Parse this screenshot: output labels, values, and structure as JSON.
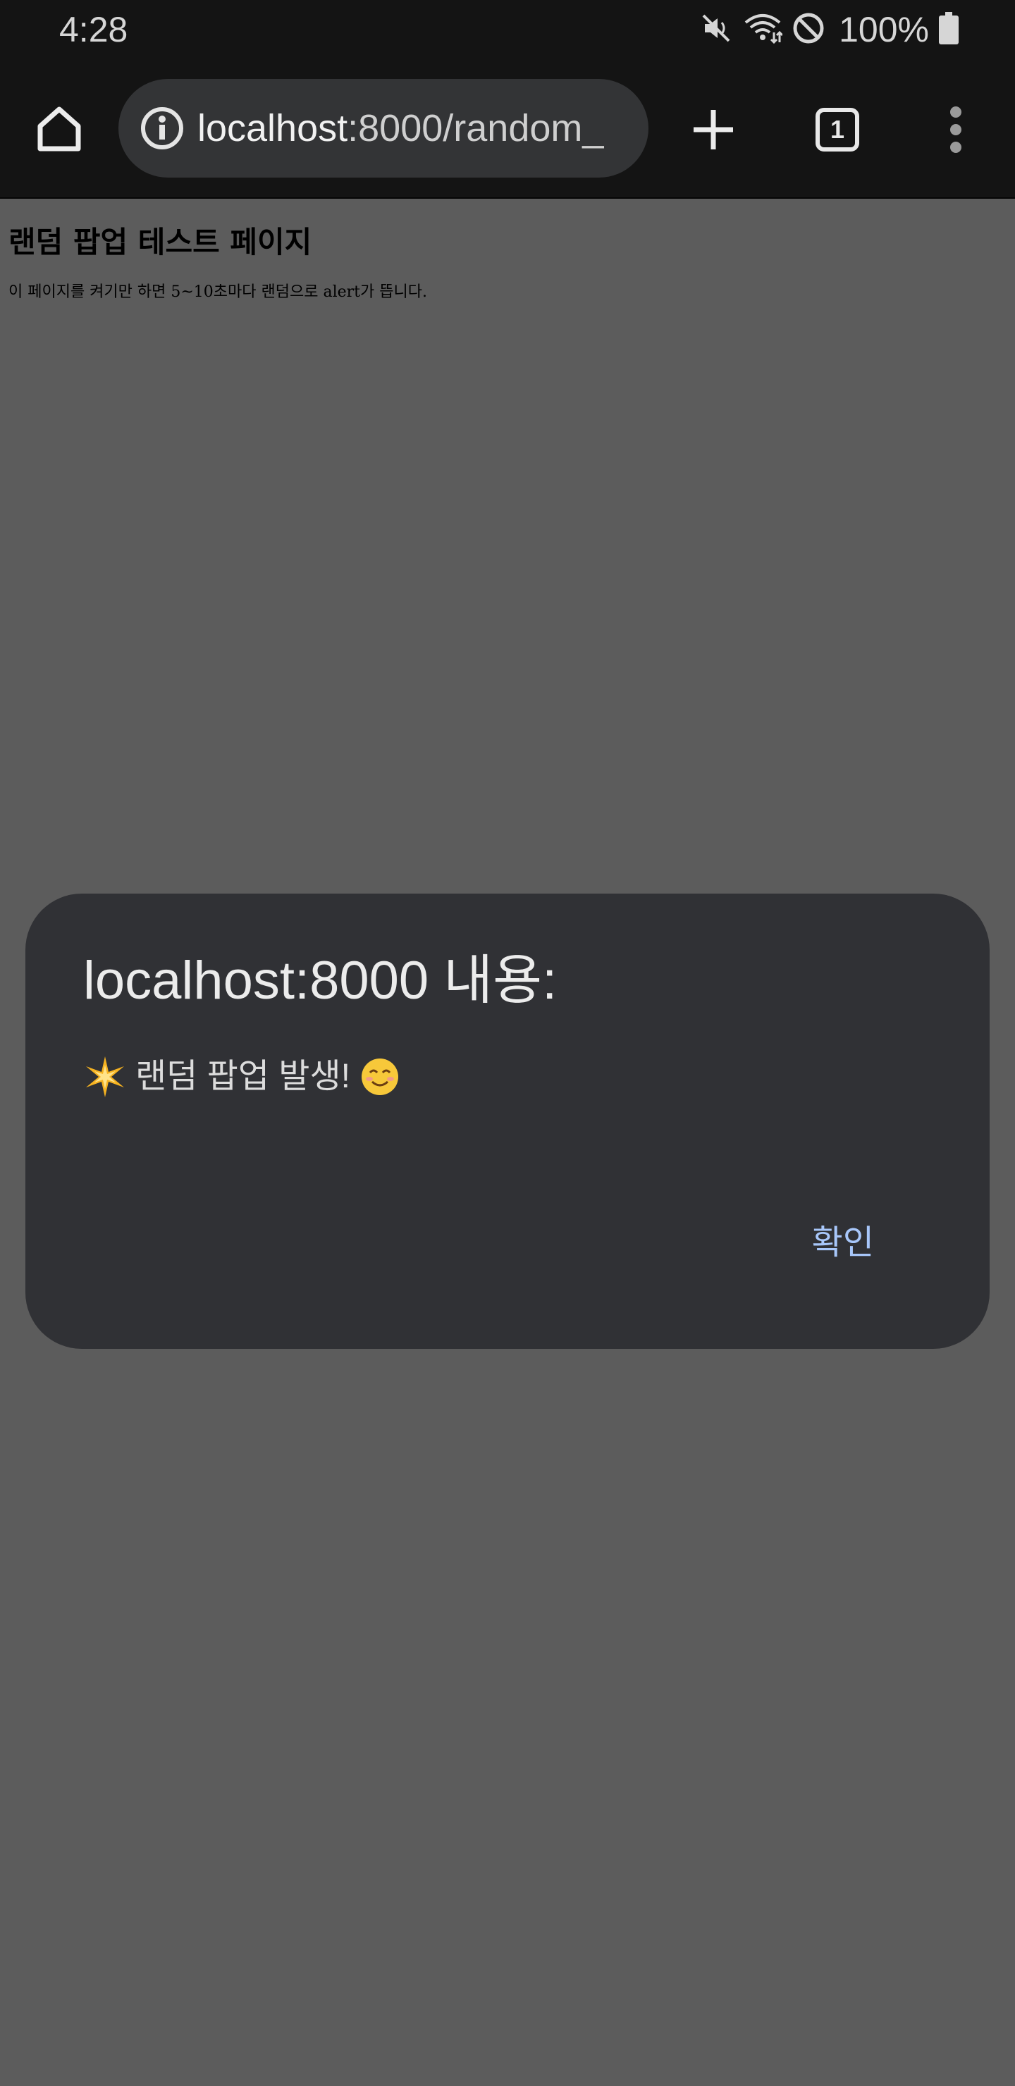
{
  "status_bar": {
    "time": "4:28",
    "battery_text": "100%",
    "icons": [
      "mute-icon",
      "wifi-icon",
      "do-not-disturb-icon",
      "battery-icon"
    ]
  },
  "toolbar": {
    "url_host": "localhost",
    "url_path": ":8000/random_",
    "tab_count": "1",
    "icons": [
      "home-icon",
      "info-icon",
      "plus-icon",
      "tab-switcher-icon",
      "more-vert-icon"
    ]
  },
  "page": {
    "title": "랜덤 팝업 테스트 페이지",
    "description": "이 페이지를 켜기만 하면 5~10초마다 랜덤으로 alert가 뜹니다."
  },
  "dialog": {
    "title": "localhost:8000 내용:",
    "message": "랜덤 팝업 발생!",
    "ok_label": "확인"
  },
  "colors": {
    "status_bar_bg": "#141414",
    "page_bg_dimmed": "#5c5c5c",
    "dialog_bg": "#303135",
    "dialog_button": "#a8c7fa"
  }
}
